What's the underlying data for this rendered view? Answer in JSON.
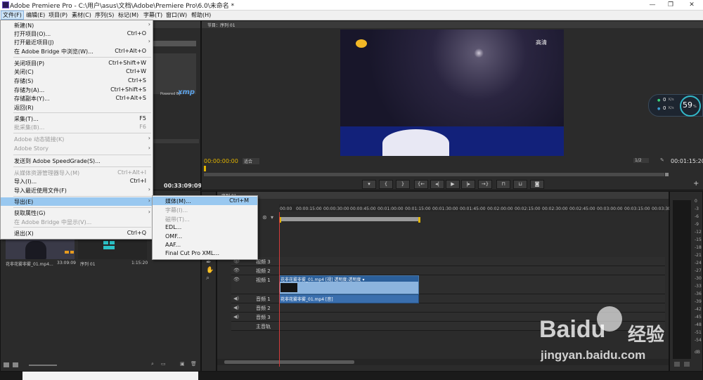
{
  "window": {
    "title": "Adobe Premiere Pro - C:\\用户\\asus\\文档\\Adobe\\Premiere Pro\\6.0\\未命名 *",
    "controls": [
      "—",
      "❐",
      "✕"
    ]
  },
  "menubar": [
    "文件(F)",
    "编辑(E)",
    "项目(P)",
    "素材(C)",
    "序列(S)",
    "标记(M)",
    "字幕(T)",
    "窗口(W)",
    "帮助(H)"
  ],
  "file_menu": [
    {
      "label": "新建(N)",
      "shortcut": "",
      "submenu": true,
      "disabled": false
    },
    {
      "label": "打开项目(O)...",
      "shortcut": "Ctrl+O",
      "submenu": false,
      "disabled": false
    },
    {
      "label": "打开最近项目(J)",
      "shortcut": "",
      "submenu": true,
      "disabled": false
    },
    {
      "label": "在 Adobe Bridge 中浏览(W)...",
      "shortcut": "Ctrl+Alt+O",
      "submenu": false,
      "disabled": false
    },
    {
      "label": "关闭项目(P)",
      "shortcut": "Ctrl+Shift+W",
      "submenu": false,
      "disabled": false
    },
    {
      "label": "关闭(C)",
      "shortcut": "Ctrl+W",
      "submenu": false,
      "disabled": false
    },
    {
      "label": "存储(S)",
      "shortcut": "Ctrl+S",
      "submenu": false,
      "disabled": false
    },
    {
      "label": "存储为(A)...",
      "shortcut": "Ctrl+Shift+S",
      "submenu": false,
      "disabled": false
    },
    {
      "label": "存储副本(Y)...",
      "shortcut": "Ctrl+Alt+S",
      "submenu": false,
      "disabled": false
    },
    {
      "label": "返回(R)",
      "shortcut": "",
      "submenu": false,
      "disabled": false
    },
    {
      "label": "采集(T)...",
      "shortcut": "F5",
      "submenu": false,
      "disabled": false
    },
    {
      "label": "批采集(B)...",
      "shortcut": "F6",
      "submenu": false,
      "disabled": true
    },
    {
      "label": "Adobe 动态链接(K)",
      "shortcut": "",
      "submenu": true,
      "disabled": true
    },
    {
      "label": "Adobe Story",
      "shortcut": "",
      "submenu": true,
      "disabled": true
    },
    {
      "label": "发送到 Adobe SpeedGrade(S)...",
      "shortcut": "",
      "submenu": false,
      "disabled": false
    },
    {
      "label": "从媒体资源管理器导入(M)",
      "shortcut": "Ctrl+Alt+I",
      "submenu": false,
      "disabled": true
    },
    {
      "label": "导入(I)...",
      "shortcut": "Ctrl+I",
      "submenu": false,
      "disabled": false
    },
    {
      "label": "导入最近使用文件(F)",
      "shortcut": "",
      "submenu": true,
      "disabled": false
    },
    {
      "label": "导出(E)",
      "shortcut": "",
      "submenu": true,
      "disabled": false,
      "highlighted": true
    },
    {
      "label": "获取属性(G)",
      "shortcut": "",
      "submenu": true,
      "disabled": false
    },
    {
      "label": "在 Adobe Bridge 中显示(V)...",
      "shortcut": "",
      "submenu": false,
      "disabled": true
    },
    {
      "label": "退出(X)",
      "shortcut": "Ctrl+Q",
      "submenu": false,
      "disabled": false
    }
  ],
  "export_menu": [
    {
      "label": "媒体(M)...",
      "shortcut": "Ctrl+M",
      "disabled": false,
      "highlighted": true
    },
    {
      "label": "字幕(I)...",
      "shortcut": "",
      "disabled": true
    },
    {
      "label": "磁带(T)...",
      "shortcut": "",
      "disabled": true
    },
    {
      "label": "EDL...",
      "shortcut": "",
      "disabled": false
    },
    {
      "label": "OMF...",
      "shortcut": "",
      "disabled": false
    },
    {
      "label": "AAF...",
      "shortcut": "",
      "disabled": false
    },
    {
      "label": "Final Cut Pro XML...",
      "shortcut": "",
      "disabled": false
    }
  ],
  "program_monitor": {
    "tab": "节目：序列 01",
    "watermark": "高清",
    "timecode_left": "00:00:00:00",
    "fit": "适合",
    "quality": "1/2",
    "timecode_right": "00:01:15:20"
  },
  "left_panel": {
    "xmp_label": "Powered By",
    "xmp_logo": "xmp",
    "duration": "00:33:09:09"
  },
  "project_items": [
    {
      "name": "花非花雾非雾_01.mp4...",
      "duration": "33:09:09"
    },
    {
      "name": "序列 01",
      "duration": "1:15:20"
    }
  ],
  "timeline": {
    "tab": "序列 01",
    "ruler": [
      "00:00",
      "00:00:15:00",
      "00:00:30:00",
      "00:00:45:00",
      "00:01:00:00",
      "00:01:15:00",
      "00:01:30:00",
      "00:01:45:00",
      "00:02:00:00",
      "00:02:15:00",
      "00:02:30:00",
      "00:02:45:00",
      "00:03:00:00",
      "00:03:15:00",
      "00:03:30:00"
    ],
    "tracks": [
      {
        "name": "视频 3"
      },
      {
        "name": "视频 2"
      },
      {
        "name": "视频 1",
        "clip": "花非花雾非雾_01.mp4 [视] 透明度:透明度 ▾"
      },
      {
        "name": "音频 1",
        "clip": "花非花雾非雾_01.mp4 [音]"
      },
      {
        "name": "音频 2"
      },
      {
        "name": "音频 3"
      },
      {
        "name": "主音轨"
      }
    ]
  },
  "net_widget": {
    "up": "0",
    "down": "0",
    "unit": "K/s",
    "percent": "59",
    "percent_unit": "%"
  },
  "audio_meter": {
    "labels": [
      "0",
      "-3",
      "-6",
      "-9",
      "-12",
      "-15",
      "-18",
      "-21",
      "-24",
      "-27",
      "-30",
      "-33",
      "-36",
      "-39",
      "-42",
      "-45",
      "-48",
      "-51",
      "-54",
      "dB"
    ]
  },
  "watermark": {
    "brand": "Baidu",
    "brand_cn": "经验",
    "url": "jingyan.baidu.com"
  },
  "colors": {
    "accent": "#e2b400",
    "menu_highlight": "#99c8f0",
    "clip_video": "#8cb4de",
    "clip_audio": "#3a6fae"
  }
}
